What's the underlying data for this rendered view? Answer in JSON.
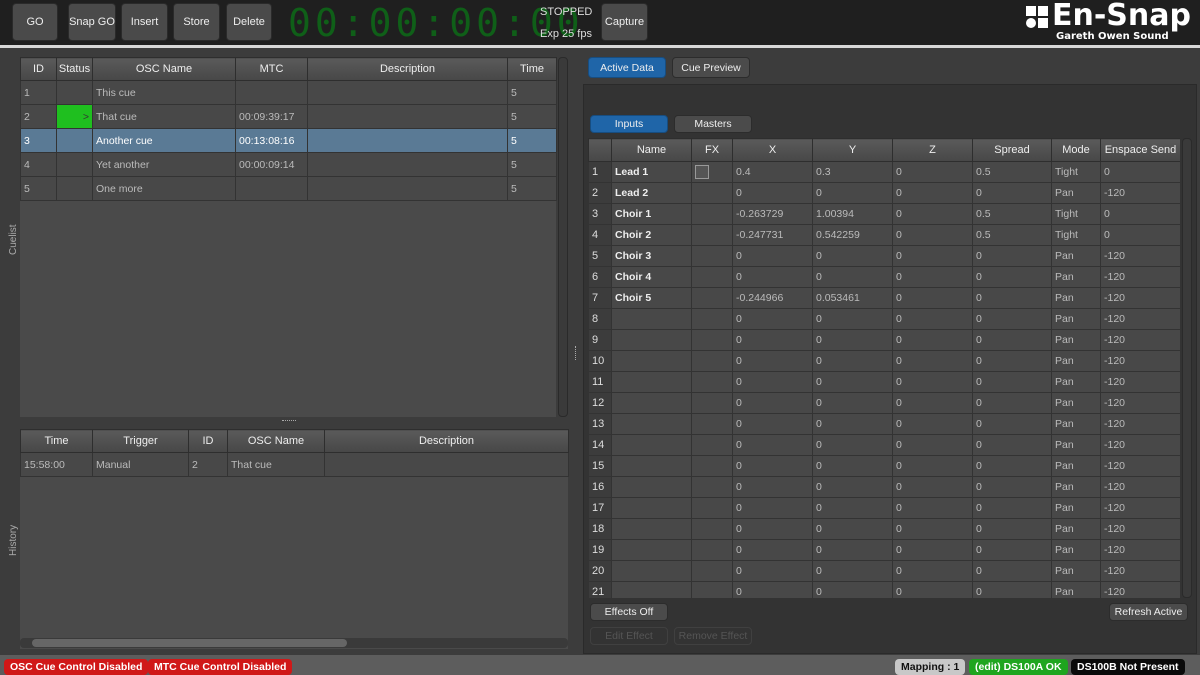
{
  "toolbar": {
    "go": "GO",
    "snap_go": "Snap GO",
    "insert": "Insert",
    "store": "Store",
    "delete": "Delete",
    "timecode": "00:00:00:00",
    "state": "STOPPED",
    "fps": "Exp 25 fps",
    "capture": "Capture",
    "timecode_color": "#0f5f18"
  },
  "logo": {
    "title": "En-Snap",
    "subtitle": "Gareth Owen Sound"
  },
  "cuelist": {
    "label": "Cuelist",
    "columns": [
      "ID",
      "Status",
      "OSC Name",
      "MTC",
      "Description",
      "Time"
    ],
    "rows": [
      [
        "1",
        "",
        "This cue",
        "",
        "",
        "5"
      ],
      [
        "2",
        ">",
        "That cue",
        "00:09:39:17",
        "",
        "5"
      ],
      [
        "3",
        "",
        "Another cue",
        "00:13:08:16",
        "",
        "5"
      ],
      [
        "4",
        "",
        "Yet another",
        "00:00:09:14",
        "",
        "5"
      ],
      [
        "5",
        "",
        "One more",
        "",
        "",
        "5"
      ]
    ],
    "active_status_color": "#1fbf1f",
    "selected_row": 3,
    "selected_color": "#5a7a95"
  },
  "history": {
    "label": "History",
    "columns": [
      "Time",
      "Trigger",
      "ID",
      "OSC Name",
      "Description"
    ],
    "rows": [
      [
        "15:58:00",
        "Manual",
        "2",
        "That cue",
        ""
      ]
    ]
  },
  "right": {
    "tabs": [
      "Active Data",
      "Cue Preview"
    ],
    "subtabs": [
      "Inputs",
      "Masters"
    ],
    "columns": [
      "",
      "Name",
      "FX",
      "X",
      "Y",
      "Z",
      "Spread",
      "Mode",
      "Enspace Send"
    ],
    "rows": [
      [
        "1",
        "Lead 1",
        "☐",
        "0.4",
        "0.3",
        "0",
        "0.5",
        "Tight",
        "0"
      ],
      [
        "2",
        "Lead 2",
        "",
        "0",
        "0",
        "0",
        "0",
        "Pan",
        "-120"
      ],
      [
        "3",
        "Choir 1",
        "",
        "-0.263729",
        "1.00394",
        "0",
        "0.5",
        "Tight",
        "0"
      ],
      [
        "4",
        "Choir 2",
        "",
        "-0.247731",
        "0.542259",
        "0",
        "0.5",
        "Tight",
        "0"
      ],
      [
        "5",
        "Choir 3",
        "",
        "0",
        "0",
        "0",
        "0",
        "Pan",
        "-120"
      ],
      [
        "6",
        "Choir 4",
        "",
        "0",
        "0",
        "0",
        "0",
        "Pan",
        "-120"
      ],
      [
        "7",
        "Choir 5",
        "",
        "-0.244966",
        "0.053461",
        "0",
        "0",
        "Pan",
        "-120"
      ],
      [
        "8",
        "",
        "",
        "0",
        "0",
        "0",
        "0",
        "Pan",
        "-120"
      ],
      [
        "9",
        "",
        "",
        "0",
        "0",
        "0",
        "0",
        "Pan",
        "-120"
      ],
      [
        "10",
        "",
        "",
        "0",
        "0",
        "0",
        "0",
        "Pan",
        "-120"
      ],
      [
        "11",
        "",
        "",
        "0",
        "0",
        "0",
        "0",
        "Pan",
        "-120"
      ],
      [
        "12",
        "",
        "",
        "0",
        "0",
        "0",
        "0",
        "Pan",
        "-120"
      ],
      [
        "13",
        "",
        "",
        "0",
        "0",
        "0",
        "0",
        "Pan",
        "-120"
      ],
      [
        "14",
        "",
        "",
        "0",
        "0",
        "0",
        "0",
        "Pan",
        "-120"
      ],
      [
        "15",
        "",
        "",
        "0",
        "0",
        "0",
        "0",
        "Pan",
        "-120"
      ],
      [
        "16",
        "",
        "",
        "0",
        "0",
        "0",
        "0",
        "Pan",
        "-120"
      ],
      [
        "17",
        "",
        "",
        "0",
        "0",
        "0",
        "0",
        "Pan",
        "-120"
      ],
      [
        "18",
        "",
        "",
        "0",
        "0",
        "0",
        "0",
        "Pan",
        "-120"
      ],
      [
        "19",
        "",
        "",
        "0",
        "0",
        "0",
        "0",
        "Pan",
        "-120"
      ],
      [
        "20",
        "",
        "",
        "0",
        "0",
        "0",
        "0",
        "Pan",
        "-120"
      ],
      [
        "21",
        "",
        "",
        "0",
        "0",
        "0",
        "0",
        "Pan",
        "-120"
      ]
    ],
    "effects_off": "Effects Off",
    "refresh_active": "Refresh Active",
    "edit_effect": "Edit Effect",
    "remove_effect": "Remove Effect"
  },
  "status": {
    "osc": "OSC Cue Control Disabled",
    "mtc": "MTC Cue Control Disabled",
    "mapping": "Mapping : 1",
    "ds100a": "(edit) DS100A OK",
    "ds100b": "DS100B Not Present"
  }
}
